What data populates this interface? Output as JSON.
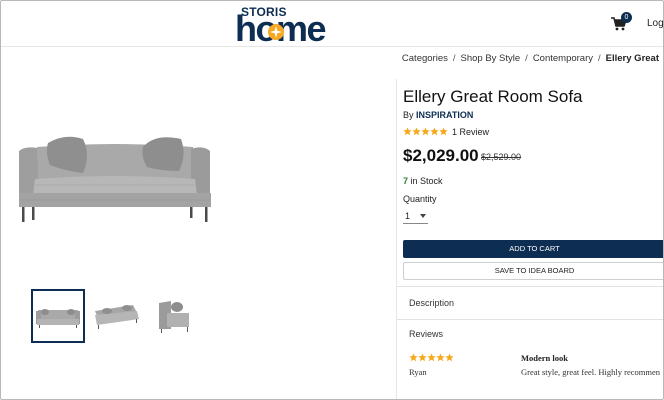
{
  "header": {
    "logo_top": "STORIS",
    "logo_main": "home",
    "cart_count": "0",
    "login_label": "Log"
  },
  "breadcrumb": [
    "Categories",
    "Shop By Style",
    "Contemporary",
    "Ellery Great"
  ],
  "product": {
    "title": "Ellery Great Room Sofa",
    "by_prefix": "By",
    "brand": "INSPIRATION",
    "rating": 5,
    "review_count_label": "1 Review",
    "price": "$2,029.00",
    "original_price": "$2,529.00",
    "stock_count": "7",
    "stock_label": "in Stock",
    "quantity_label": "Quantity",
    "quantity_value": "1",
    "add_to_cart": "ADD TO CART",
    "save_to_idea_board": "SAVE TO IDEA BOARD"
  },
  "sections": {
    "description": "Description",
    "reviews": "Reviews"
  },
  "review": {
    "stars": 5,
    "author": "Ryan",
    "title": "Modern look",
    "body": "Great style, great feel. Highly recommen"
  },
  "thumbnails": [
    "front-view",
    "angled-view",
    "side-view"
  ],
  "colors": {
    "brand_navy": "#0d2d52",
    "star_gold": "#f6a91b",
    "stock_green": "#2e7d32",
    "logo_accent": "#f7a823"
  },
  "icons": [
    "cart-icon",
    "star-icon",
    "dropdown-caret-icon"
  ]
}
